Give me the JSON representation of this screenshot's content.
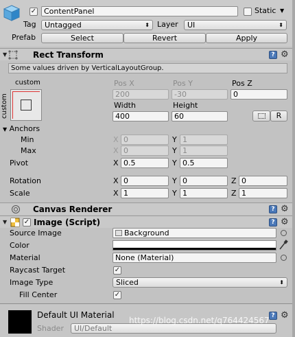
{
  "gameobject": {
    "active": true,
    "name": "ContentPanel",
    "static_label": "Static",
    "static_checked": false,
    "tag_label": "Tag",
    "tag_value": "Untagged",
    "layer_label": "Layer",
    "layer_value": "UI",
    "prefab_label": "Prefab",
    "prefab_buttons": [
      "Select",
      "Revert",
      "Apply"
    ]
  },
  "rect_transform": {
    "title": "Rect Transform",
    "info": "Some values driven by VerticalLayoutGroup.",
    "anchor_preset_top": "custom",
    "anchor_preset_side": "custom",
    "pos_x_label": "Pos X",
    "pos_y_label": "Pos Y",
    "pos_z_label": "Pos Z",
    "pos_x": "200",
    "pos_y": "-30",
    "pos_z": "0",
    "width_label": "Width",
    "height_label": "Height",
    "width": "400",
    "height": "60",
    "blueprint_label": "",
    "raw_label": "R",
    "anchors_label": "Anchors",
    "min_label": "Min",
    "max_label": "Max",
    "min_x": "0",
    "min_y": "1",
    "max_x": "0",
    "max_y": "1",
    "pivot_label": "Pivot",
    "pivot_x": "0.5",
    "pivot_y": "0.5",
    "rotation_label": "Rotation",
    "rot_x": "0",
    "rot_y": "0",
    "rot_z": "0",
    "scale_label": "Scale",
    "scale_x": "1",
    "scale_y": "1",
    "scale_z": "1",
    "x": "X",
    "y": "Y",
    "z": "Z"
  },
  "canvas_renderer": {
    "title": "Canvas Renderer"
  },
  "image": {
    "title": "Image (Script)",
    "enabled": true,
    "source_image_label": "Source Image",
    "source_image_value": "Background",
    "color_label": "Color",
    "color_value": "#ffffff",
    "material_label": "Material",
    "material_value": "None (Material)",
    "raycast_label": "Raycast Target",
    "raycast_checked": true,
    "image_type_label": "Image Type",
    "image_type_value": "Sliced",
    "fill_center_label": "Fill Center",
    "fill_center_checked": true
  },
  "material_preview": {
    "name": "Default UI Material",
    "shader_label": "Shader",
    "shader_value": "UI/Default"
  },
  "watermark": "https://blog.csdn.net/q764424567",
  "icons": {
    "cube": "cube-icon",
    "help": "help-icon",
    "gear": "gear-icon",
    "eyedropper": "eyedropper-icon",
    "object_picker": "object-picker-icon"
  }
}
